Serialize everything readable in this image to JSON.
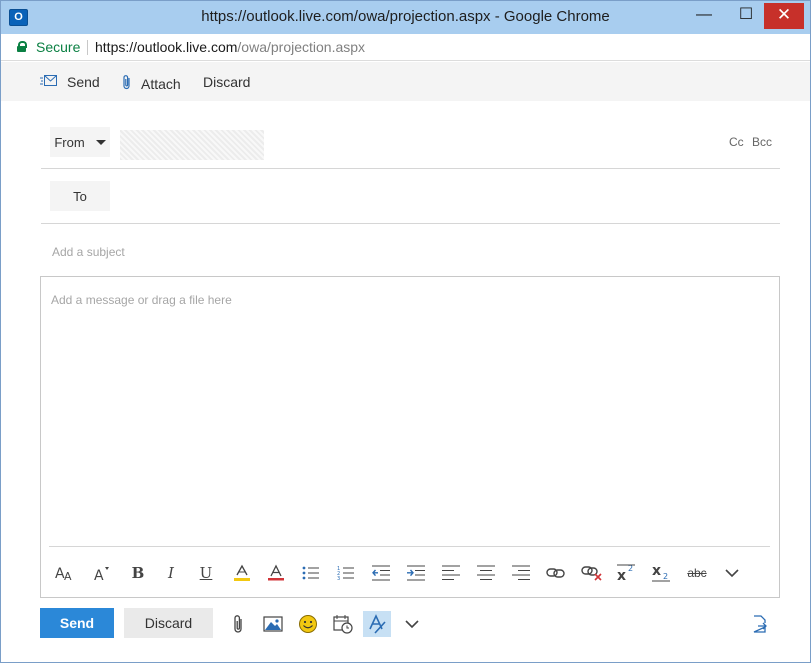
{
  "window": {
    "app_icon_letter": "O",
    "title": "https://outlook.live.com/owa/projection.aspx - Google Chrome",
    "minimize_glyph": "—",
    "maximize_glyph": "☐",
    "close_glyph": "✕"
  },
  "address_bar": {
    "secure_label": "Secure",
    "url_host": "https://outlook.live.com",
    "url_path": "/owa/projection.aspx"
  },
  "command_bar": {
    "send_label": "Send",
    "attach_label": "Attach",
    "discard_label": "Discard"
  },
  "compose": {
    "from_label": "From",
    "to_label": "To",
    "cc_label": "Cc",
    "bcc_label": "Bcc",
    "subject_placeholder": "Add a subject",
    "body_placeholder": "Add a message or drag a file here"
  },
  "formatting_toolbar": {
    "bold_glyph": "B",
    "italic_glyph": "I",
    "underline_glyph": "U",
    "strikethrough_glyph": "abc",
    "highlight_color": "#f2c811",
    "font_color": "#d13438"
  },
  "footer": {
    "send_label": "Send",
    "discard_label": "Discard"
  },
  "colors": {
    "accent": "#2b88d8",
    "titlebar": "#a8cdef",
    "secure": "#0b8043",
    "close": "#c7302a"
  }
}
